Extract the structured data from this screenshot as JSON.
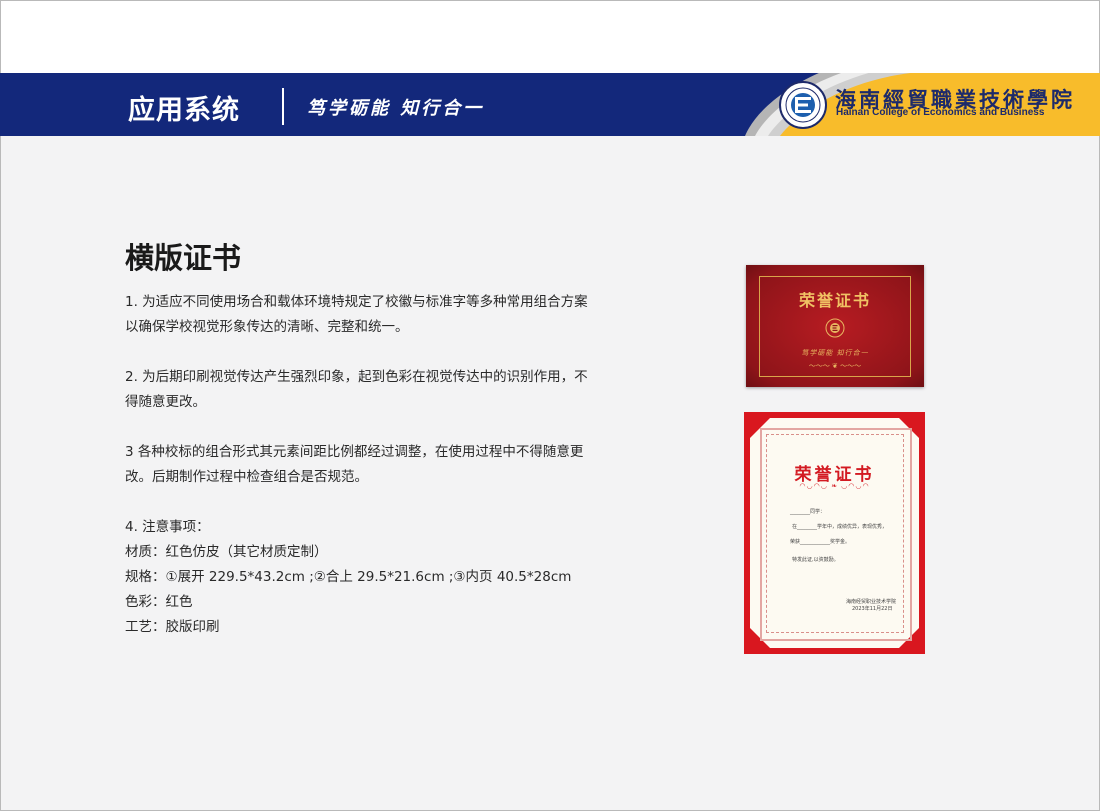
{
  "header": {
    "section_title": "应用系统",
    "motto": "笃学砺能 知行合一",
    "logo": {
      "name_cn": "海南經貿職業技術學院",
      "name_en": "Hainan College of Economics and Business",
      "icon": "college-emblem-icon"
    },
    "colors": {
      "navy": "#13287b",
      "gold": "#f8bc2b",
      "grey_swoosh": "#b5b5b5"
    }
  },
  "main": {
    "title": "横版证书",
    "paragraphs": [
      "1. 为适应不同使用场合和载体环境特规定了校徽与标准字等多种常用组合方案 以确保学校视觉形象传达的清晰、完整和统一。",
      "2. 为后期印刷视觉传达产生强烈印象，起到色彩在视觉传达中的识别作用，不得随意更改。",
      "3 各种校标的组合形式其元素间距比例都经过调整，在使用过程中不得随意更改。后期制作过程中检查组合是否规范。"
    ],
    "notes": [
      "4. 注意事项：",
      "材质：红色仿皮（其它材质定制）",
      "规格：①展开 229.5*43.2cm ;②合上 29.5*21.6cm ;③内页 40.5*28cm",
      "色彩：红色",
      "工艺：胶版印刷"
    ]
  },
  "certificates": {
    "cover": {
      "title": "荣誉证书",
      "motto": "笃学砺能 知行合一",
      "color": "#a3171d"
    },
    "inner": {
      "title": "荣誉证书",
      "lines": [
        "________同学：",
        "在________学年中，成绩优异，表现优秀，",
        "荣获____________奖学金。",
        "特发此证,以资鼓励。",
        "海南经贸职业技术学院",
        "2023年11月22日"
      ],
      "color": "#d9171f"
    }
  }
}
